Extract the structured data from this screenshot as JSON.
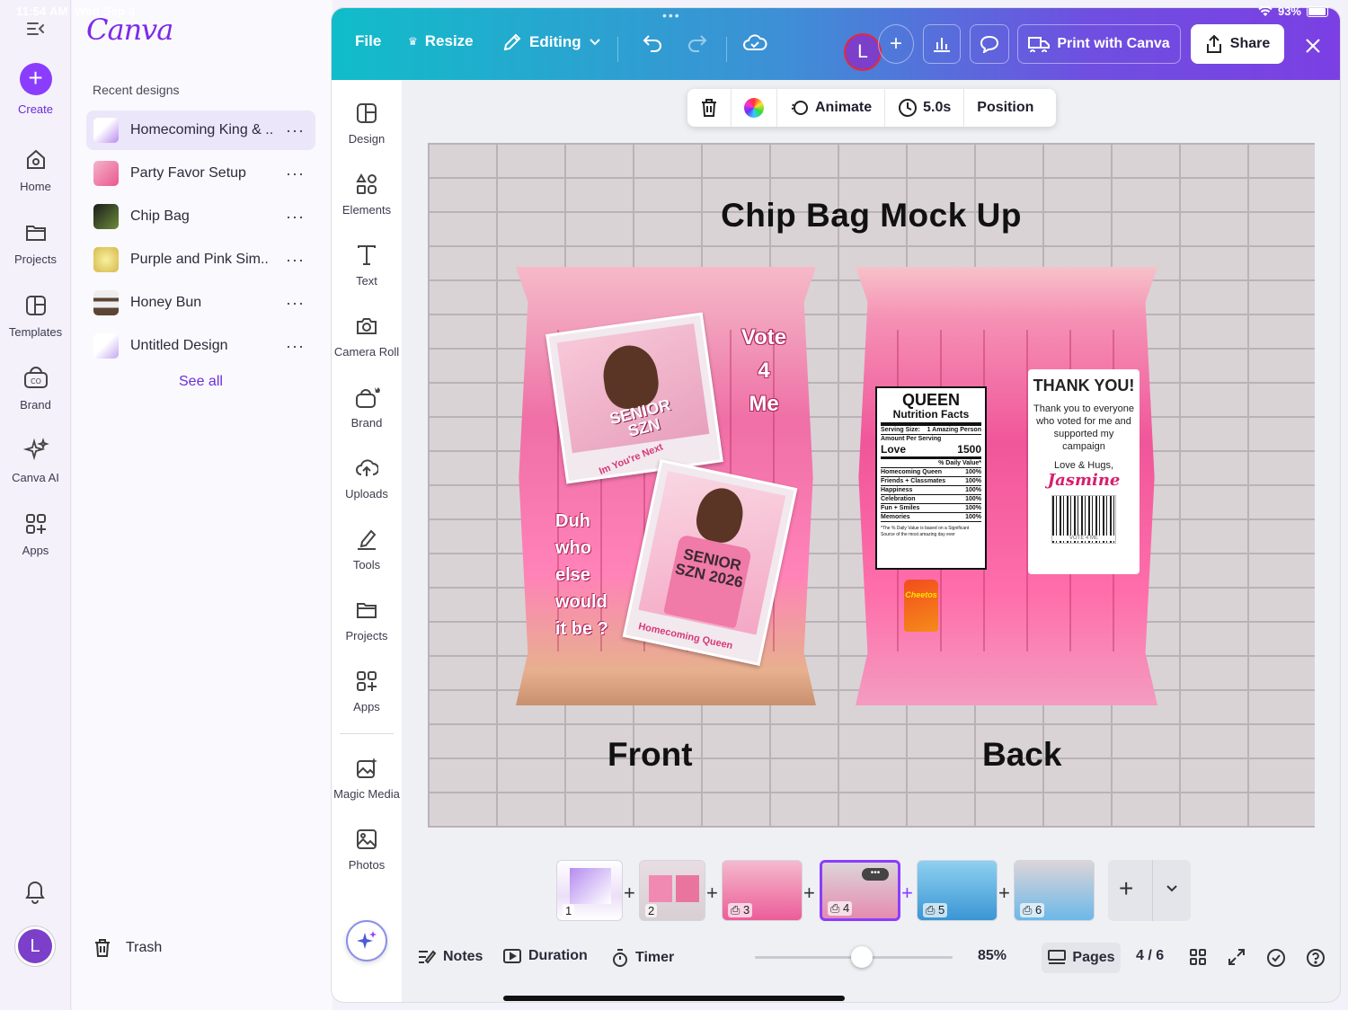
{
  "status": {
    "time": "11:54 AM",
    "date": "Wed Sep 3",
    "battery": "93%"
  },
  "rail": {
    "create": "Create",
    "items": [
      "Home",
      "Projects",
      "Templates",
      "Brand",
      "Canva AI",
      "Apps"
    ],
    "avatar_letter": "L"
  },
  "panel": {
    "logo": "Canva",
    "section_label": "Recent designs",
    "designs": [
      {
        "name": "Homecoming King & ..",
        "active": true
      },
      {
        "name": "Party Favor Setup",
        "active": false
      },
      {
        "name": "Chip Bag",
        "active": false
      },
      {
        "name": "Purple and Pink Sim..",
        "active": false
      },
      {
        "name": "Honey Bun",
        "active": false
      },
      {
        "name": "Untitled Design",
        "active": false
      }
    ],
    "more_glyph": "···",
    "see_all": "See all",
    "trash": "Trash"
  },
  "topbar": {
    "file": "File",
    "resize": "Resize",
    "editing": "Editing",
    "avatar_letter": "L",
    "print": "Print with Canva",
    "share": "Share"
  },
  "sidebar": {
    "items": [
      "Design",
      "Elements",
      "Text",
      "Camera Roll",
      "Brand",
      "Uploads",
      "Tools",
      "Projects",
      "Apps",
      "Magic Media",
      "Photos"
    ]
  },
  "context_toolbar": {
    "animate": "Animate",
    "duration": "5.0s",
    "position": "Position"
  },
  "canvas": {
    "title": "Chip Bag Mock Up",
    "front_label": "Front",
    "back_label": "Back",
    "front": {
      "vote": [
        "Vote",
        "4",
        "Me"
      ],
      "duh": [
        "Duh",
        "who",
        "else",
        "would",
        "it be ?"
      ],
      "senior_1": "SENIOR SZN",
      "caption_1": "Im You're Next",
      "senior_2": "SENIOR SZN 2026",
      "caption_2": "Homecoming Queen"
    },
    "back": {
      "nutrition_title": "QUEEN",
      "nutrition_sub": "Nutrition Facts",
      "serving_label": "Serving Size:",
      "serving_value": "1 Amazing Person",
      "amount_label": "Amount Per Serving",
      "love_label": "Love",
      "love_value": "1500",
      "dv_label": "% Daily Value*",
      "rows": [
        {
          "label": "Homecoming Queen",
          "value": "100%"
        },
        {
          "label": "Friends + Classmates",
          "value": "100%"
        },
        {
          "label": "Happiness",
          "value": "100%"
        },
        {
          "label": "Celebration",
          "value": "100%"
        },
        {
          "label": "Fun + Smiles",
          "value": "100%"
        },
        {
          "label": "Memories",
          "value": "100%"
        }
      ],
      "footnote": "*The % Daily Value is based on a Significant Source of the most amazing day ever",
      "chips_brand": "Cheetos",
      "thanks_title": "THANK YOU!",
      "thanks_body": "Thank you to everyone who voted for me and supported my campaign",
      "signoff": "Love & Hugs,",
      "signature": "Jasmine",
      "barcode_text": "VOTE 4 ME"
    }
  },
  "pages": {
    "numbers": [
      "1",
      "2",
      "3",
      "4",
      "5",
      "6"
    ],
    "active": 4
  },
  "bottom": {
    "notes": "Notes",
    "duration": "Duration",
    "timer": "Timer",
    "zoom": "85%",
    "pages": "Pages",
    "page_count": "4 / 6"
  },
  "colors": {
    "accent": "#8b3dff",
    "topbar_start": "#10bdc9",
    "topbar_end": "#7b3fe3"
  }
}
